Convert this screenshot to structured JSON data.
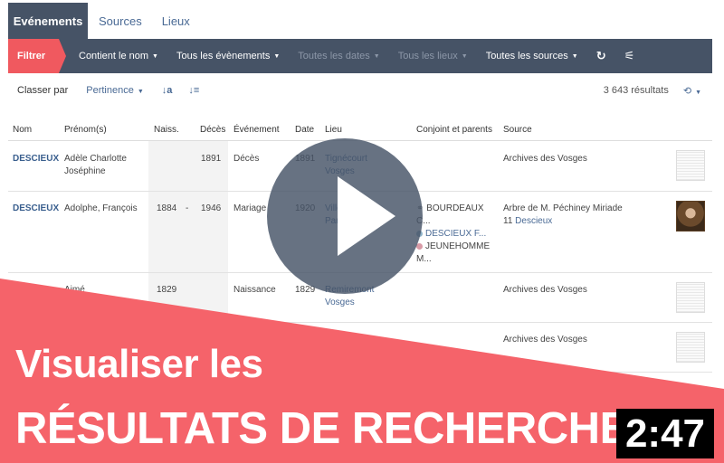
{
  "tabs": [
    {
      "label": "Evénements",
      "active": true
    },
    {
      "label": "Sources",
      "active": false
    },
    {
      "label": "Lieux",
      "active": false
    }
  ],
  "filterbar": {
    "filter_label": "Filtrer",
    "items": [
      {
        "label": "Contient le nom",
        "enabled": true
      },
      {
        "label": "Tous les évènements",
        "enabled": true
      },
      {
        "label": "Toutes les dates",
        "enabled": false
      },
      {
        "label": "Tous les lieux",
        "enabled": false
      },
      {
        "label": "Toutes les sources",
        "enabled": true
      }
    ],
    "icons": [
      "refresh-icon",
      "sliders-icon"
    ]
  },
  "sortbar": {
    "label": "Classer par",
    "selected": "Pertinence",
    "results": "3 643 résultats"
  },
  "table": {
    "headers": [
      "Nom",
      "Prénom(s)",
      "Naiss.",
      "Décès",
      "Événement",
      "Date",
      "Lieu",
      "Conjoint et parents",
      "Source"
    ],
    "rows": [
      {
        "nom": "DESCIEUX",
        "prenom_1": "Adèle Charlotte",
        "prenom_2": "Joséphine",
        "naiss": "",
        "sep": "",
        "deces": "1891",
        "evenement": "Décès",
        "date": "1891",
        "lieu_1": "Tignécourt",
        "lieu_2": "Vosges",
        "source": "Archives des Vosges",
        "source_link": "",
        "thumb": "document"
      },
      {
        "nom": "DESCIEUX",
        "prenom_1": "Adolphe, François",
        "prenom_2": "",
        "naiss": "1884",
        "sep": "-",
        "deces": "1946",
        "evenement": "Mariage",
        "date": "1920",
        "lieu_1": "Villemomble",
        "lieu_2": "Paris",
        "source": "Arbre de M. Péchiney Miriade",
        "source_count": "11",
        "source_link": "Descieux",
        "thumb": "photo",
        "relatives": [
          {
            "icon": "spouse-icon",
            "name": "BOURDEAUX",
            "name_2": "C..."
          },
          {
            "icon": "father-icon",
            "name": "DESCIEUX F...",
            "name_2": ""
          },
          {
            "icon": "mother-icon",
            "name": "JEUNEHOMME",
            "name_2": "M..."
          }
        ]
      },
      {
        "nom": "",
        "prenom_1": "Aimé",
        "prenom_2": "",
        "naiss": "1829",
        "sep": "",
        "deces": "",
        "evenement": "Naissance",
        "date": "1829",
        "lieu_1": "Remiremont",
        "lieu_2": "Vosges",
        "source": "Archives des Vosges",
        "source_link": "",
        "thumb": "document"
      },
      {
        "nom": "",
        "prenom_1": "",
        "prenom_2": "",
        "naiss": "",
        "sep": "",
        "deces": "",
        "evenement": "",
        "date": "",
        "lieu_1": "",
        "lieu_2": "",
        "source": "Archives des Vosges",
        "source_link": "",
        "thumb": "document"
      }
    ]
  },
  "overlay": {
    "title_line1": "Visualiser les",
    "title_line2": "RÉSULTATS DE RECHERCHE",
    "duration": "2:47",
    "accent": "#f5636a"
  }
}
